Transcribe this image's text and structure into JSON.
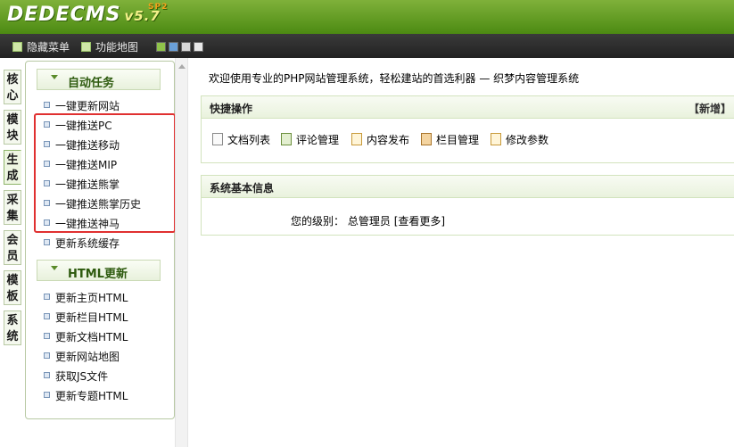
{
  "header": {
    "logo_text": "DEDECMS",
    "version": "v5.7",
    "edition_tag": "SP2"
  },
  "menubar": {
    "items": [
      "隐藏菜单",
      "功能地图"
    ],
    "skin_colors": [
      "#8fc34a",
      "#6aa0d8",
      "#d8d8d8",
      "#e8e8e8"
    ]
  },
  "left_tabs": [
    "核\n心",
    "模\n块",
    "生\n成",
    "采\n集",
    "会\n员",
    "模\n板",
    "系\n统"
  ],
  "left_tabs_active": "生成",
  "sidebar": {
    "section1": {
      "title": "自动任务",
      "items": [
        "一键更新网站",
        "一键推送PC",
        "一键推送移动",
        "一键推送MIP",
        "一键推送熊掌",
        "一键推送熊掌历史",
        "一键推送神马",
        "更新系统缓存"
      ]
    },
    "section2": {
      "title": "HTML更新",
      "items": [
        "更新主页HTML",
        "更新栏目HTML",
        "更新文档HTML",
        "更新网站地图",
        "获取JS文件",
        "更新专题HTML"
      ]
    }
  },
  "main": {
    "welcome": "欢迎使用专业的PHP网站管理系统，轻松建站的首选利器 — 织梦内容管理系统",
    "quick_panel": {
      "title": "快捷操作",
      "action": "【新增】",
      "links": [
        "文档列表",
        "评论管理",
        "内容发布",
        "栏目管理",
        "修改参数"
      ]
    },
    "info_panel": {
      "title": "系统基本信息",
      "level_label": "您的级别：",
      "level_value": "总管理员",
      "more_link": "[查看更多]"
    }
  },
  "colors": {
    "header_green": "#5f9c1f",
    "highlight_border": "#e03030"
  }
}
